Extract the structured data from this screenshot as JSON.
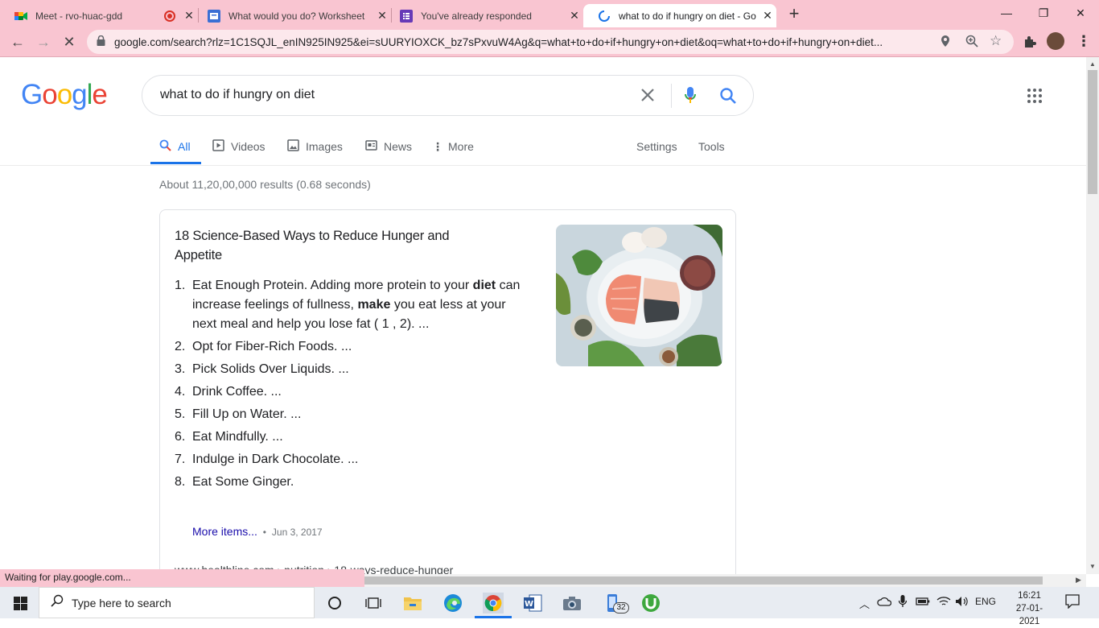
{
  "browser": {
    "tabs": [
      {
        "title": "Meet - rvo-huac-gdd",
        "icon": "google-meet-icon",
        "recording": true
      },
      {
        "title": "What would you do? Worksheet",
        "icon": "worksheet-icon"
      },
      {
        "title": "You've already responded",
        "icon": "google-forms-icon"
      },
      {
        "title": "what to do if hungry on diet - Go",
        "icon": "loading-spinner-icon",
        "active": true
      }
    ],
    "new_tab": "+",
    "url": "google.com/search?rlz=1C1SQJL_enIN925IN925&ei=sUURYIOXCK_bz7sPxvuW4Ag&q=what+to+do+if+hungry+on+diet&oq=what+to+do+if+hungry+on+diet...",
    "status": "Waiting for play.google.com..."
  },
  "google": {
    "logo": [
      "G",
      "o",
      "o",
      "g",
      "l",
      "e"
    ],
    "logo_colors": [
      "#4285f4",
      "#ea4335",
      "#fbbc05",
      "#4285f4",
      "#34a853",
      "#ea4335"
    ],
    "query": "what to do if hungry on diet",
    "tabs": [
      {
        "label": "All",
        "icon": "search-icon"
      },
      {
        "label": "Videos",
        "icon": "video-icon"
      },
      {
        "label": "Images",
        "icon": "image-icon"
      },
      {
        "label": "News",
        "icon": "news-icon"
      },
      {
        "label": "More",
        "icon": "more-vert-icon"
      }
    ],
    "settings": "Settings",
    "tools": "Tools",
    "stats": "About 11,20,00,000 results (0.68 seconds)"
  },
  "snippet": {
    "title": "18 Science-Based Ways to Reduce Hunger and Appetite",
    "steps": [
      {
        "num": "1.",
        "parts": [
          {
            "t": "Eat Enough Protein. Adding more protein to your ",
            "b": false
          },
          {
            "t": "diet",
            "b": true
          },
          {
            "t": " can increase feelings of fullness, ",
            "b": false
          },
          {
            "t": "make",
            "b": true
          },
          {
            "t": " you eat less at your next meal and help you lose fat ( 1 , 2). ...",
            "b": false
          }
        ]
      },
      {
        "num": "2.",
        "parts": [
          {
            "t": "Opt for Fiber-Rich Foods. ...",
            "b": false
          }
        ]
      },
      {
        "num": "3.",
        "parts": [
          {
            "t": "Pick Solids Over Liquids. ...",
            "b": false
          }
        ]
      },
      {
        "num": "4.",
        "parts": [
          {
            "t": "Drink Coffee. ...",
            "b": false
          }
        ]
      },
      {
        "num": "5.",
        "parts": [
          {
            "t": "Fill Up on Water. ...",
            "b": false
          }
        ]
      },
      {
        "num": "6.",
        "parts": [
          {
            "t": "Eat Mindfully. ...",
            "b": false
          }
        ]
      },
      {
        "num": "7.",
        "parts": [
          {
            "t": "Indulge in Dark Chocolate. ...",
            "b": false
          }
        ]
      },
      {
        "num": "8.",
        "parts": [
          {
            "t": "Eat Some Ginger.",
            "b": false
          }
        ]
      }
    ],
    "more_items": "More items...",
    "bullet": "•",
    "date": "Jun 3, 2017",
    "cite": "www.healthline.com › nutrition › 18-ways-reduce-hunger"
  },
  "taskbar": {
    "search_placeholder": "Type here to search",
    "badge": "32",
    "lang": "ENG",
    "time": "16:21",
    "date": "27-01-2021"
  }
}
